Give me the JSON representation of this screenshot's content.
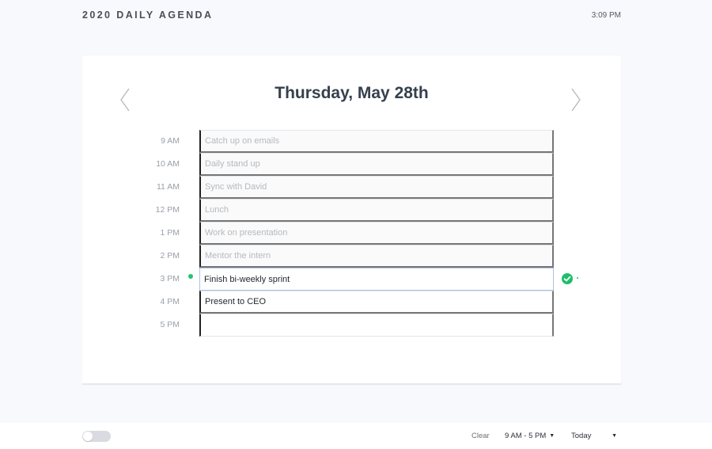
{
  "header": {
    "app_title": "2020 DAILY AGENDA",
    "clock": "3:09 PM"
  },
  "agenda": {
    "date_title": "Thursday, May 28th",
    "prev_icon": "chevron-left-icon",
    "next_icon": "chevron-right-icon",
    "slots": [
      {
        "time": "9 AM",
        "task": "Catch up on emails",
        "state": "past"
      },
      {
        "time": "10 AM",
        "task": "Daily stand up",
        "state": "past"
      },
      {
        "time": "11 AM",
        "task": "Sync with David",
        "state": "past"
      },
      {
        "time": "12 PM",
        "task": "Lunch",
        "state": "past"
      },
      {
        "time": "1 PM",
        "task": "Work on presentation",
        "state": "past"
      },
      {
        "time": "2 PM",
        "task": "Mentor the intern",
        "state": "past"
      },
      {
        "time": "3 PM",
        "task": "Finish bi-weekly sprint",
        "state": "current"
      },
      {
        "time": "4 PM",
        "task": "Present to CEO",
        "state": "future"
      },
      {
        "time": "5 PM",
        "task": "",
        "state": "future"
      }
    ],
    "save_icon": "check-circle-icon"
  },
  "footer": {
    "clear_label": "Clear",
    "hours_range": "9 AM - 5 PM",
    "day_option": "Today",
    "caret_icon": "caret-down-icon"
  },
  "colors": {
    "accent_green": "#1fbe6b",
    "focus_border": "#a9c2e6",
    "background": "#f8f9fd"
  }
}
